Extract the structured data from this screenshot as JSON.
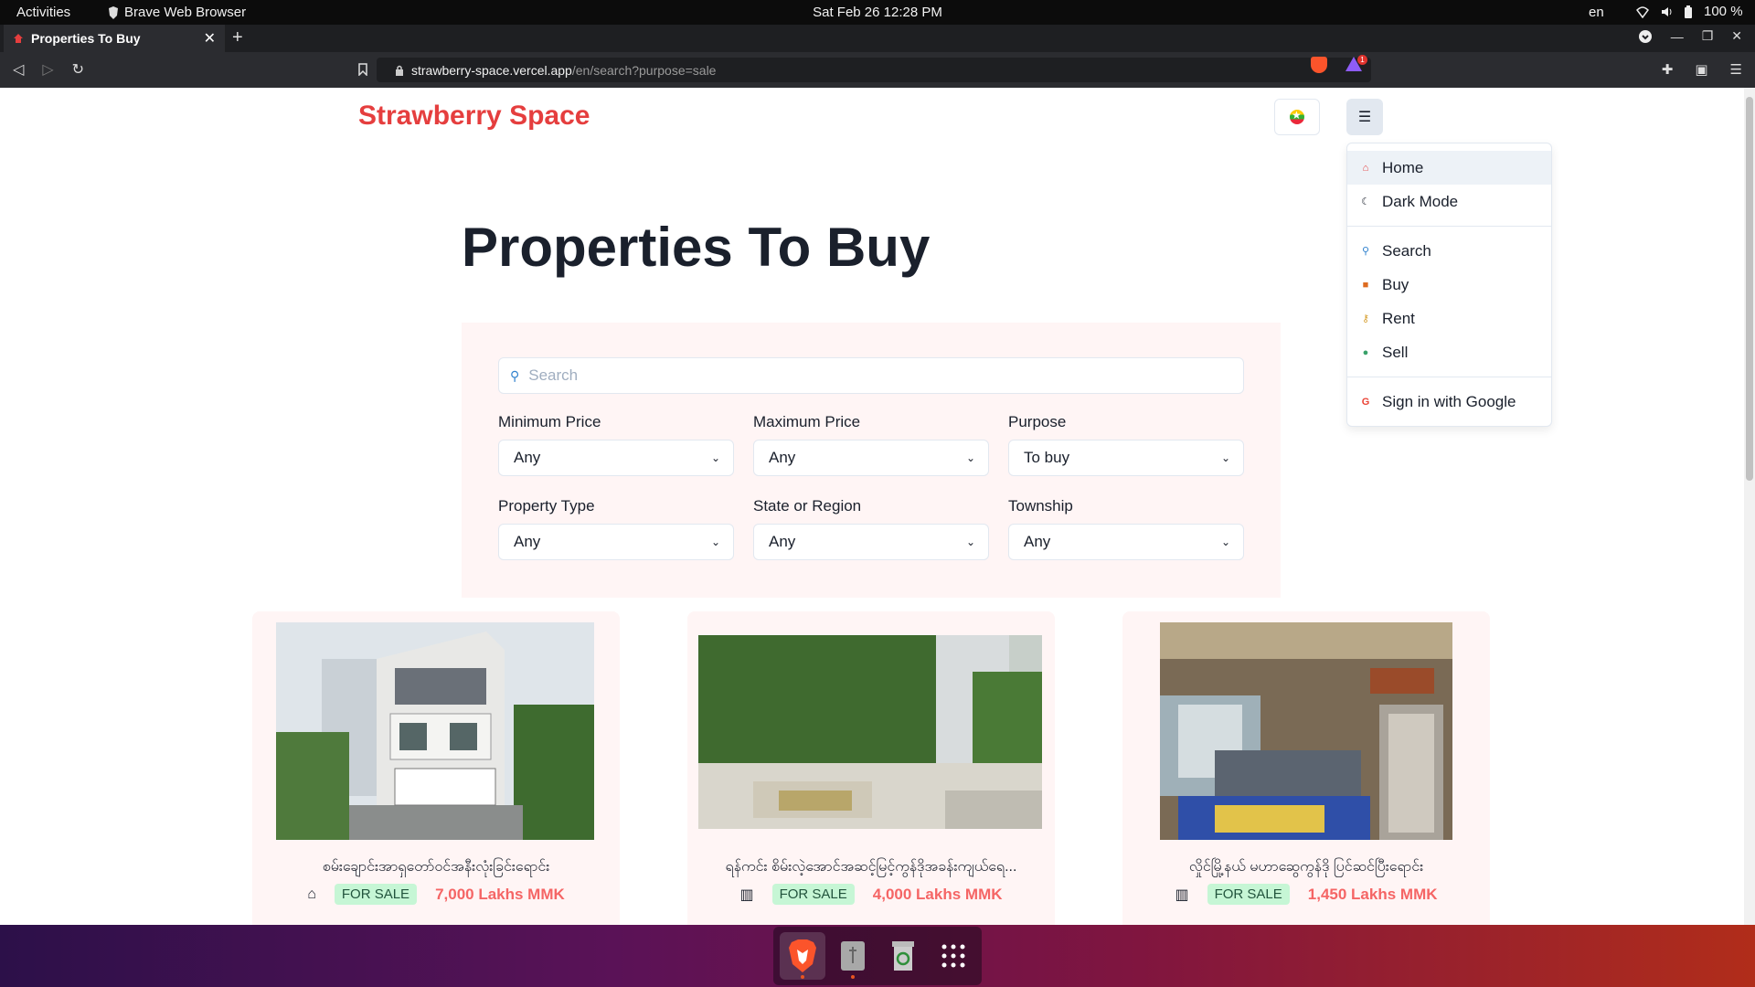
{
  "system": {
    "activities": "Activities",
    "app_name": "Brave Web Browser",
    "clock": "Sat Feb 26  12:28 PM",
    "lang": "en",
    "battery": "100 %"
  },
  "browser": {
    "tab_title": "Properties To Buy",
    "url_host": "strawberry-space.vercel.app",
    "url_path": "/en/search?purpose=sale",
    "rewards_badge": "1"
  },
  "site": {
    "brand": "Strawberry Space",
    "menu": {
      "items_top": [
        {
          "label": "Home",
          "icon": "home-icon"
        },
        {
          "label": "Dark Mode",
          "icon": "moon-icon"
        }
      ],
      "items_mid": [
        {
          "label": "Search",
          "icon": "search-icon"
        },
        {
          "label": "Buy",
          "icon": "lock-icon"
        },
        {
          "label": "Rent",
          "icon": "key-icon"
        },
        {
          "label": "Sell",
          "icon": "money-icon"
        }
      ],
      "items_bottom": [
        {
          "label": "Sign in with Google",
          "icon": "google-icon"
        }
      ]
    }
  },
  "main": {
    "heading": "Properties To Buy",
    "search": {
      "placeholder": "Search"
    },
    "filters": {
      "min_price": {
        "label": "Minimum Price",
        "value": "Any"
      },
      "max_price": {
        "label": "Maximum Price",
        "value": "Any"
      },
      "purpose": {
        "label": "Purpose",
        "value": "To buy"
      },
      "property_type": {
        "label": "Property Type",
        "value": "Any"
      },
      "state_region": {
        "label": "State or Region",
        "value": "Any"
      },
      "township": {
        "label": "Township",
        "value": "Any"
      }
    },
    "listings": [
      {
        "title": "စမ်းချောင်းအာရှတော်ဝင်အနီးလုံးခြင်းရောင်း",
        "type_icon": "house-icon",
        "badge": "FOR SALE",
        "price": "7,000 Lakhs MMK"
      },
      {
        "title": "ရန်ကင်း စိမ်းလဲ့အောင်အဆင့်မြင့်ကွန်ဒိုအခန်းကျယ်ရေ...",
        "type_icon": "building-icon",
        "badge": "FOR SALE",
        "price": "4,000 Lakhs MMK"
      },
      {
        "title": "လှိုင်မြို့နယ် မဟာဆွေကွန်ဒို ပြင်ဆင်ပြီးရောင်း",
        "type_icon": "building-icon",
        "badge": "FOR SALE",
        "price": "1,450 Lakhs MMK"
      }
    ]
  },
  "colors": {
    "brand": "#e53e3e",
    "filter_bg": "#fff5f5",
    "badge_bg": "#c6f6d5",
    "price": "#f56565"
  }
}
